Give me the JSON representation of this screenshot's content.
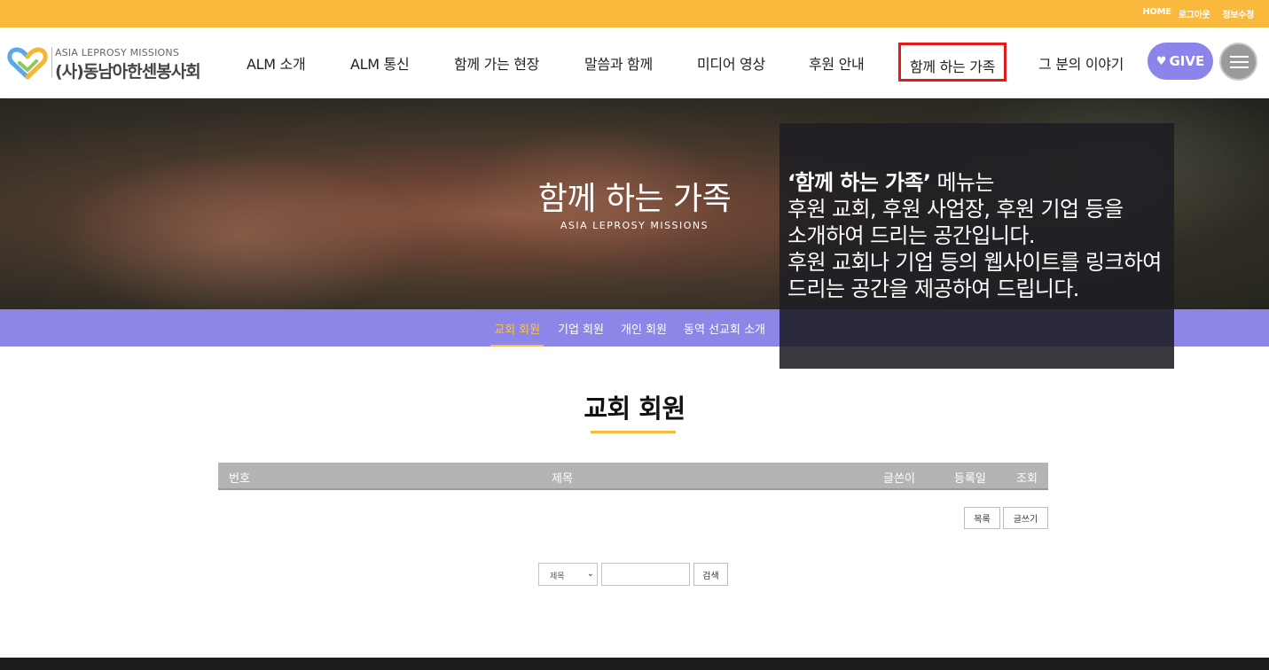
{
  "topbar": {
    "links": [
      "HOME",
      "로그아웃",
      "정보수정"
    ]
  },
  "logo": {
    "sub": "ASIA LEPROSY MISSIONS",
    "name": "(사)동남아한센봉사회"
  },
  "nav": {
    "items": [
      "ALM 소개",
      "ALM 통신",
      "함께 가는 현장",
      "말씀과 함께",
      "미디어 영상",
      "후원 안내",
      "함께 하는 가족",
      "그 분의 이야기"
    ],
    "active_index": 6,
    "give_label": "GIVE"
  },
  "hero": {
    "title": "함께 하는 가족",
    "subtitle": "ASIA LEPROSY MISSIONS"
  },
  "subnav": {
    "tabs": [
      "교회 회원",
      "기업 회원",
      "개인 회원",
      "동역 선교회 소개"
    ],
    "active_index": 0
  },
  "tooltip": {
    "highlight": "‘함께 하는 가족’",
    "line1_rest": " 메뉴는",
    "line2": "후원 교회, 후원 사업장, 후원 기업 등을",
    "line3": "소개하여 드리는 공간입니다.",
    "line4": "후원 교회나 기업 등의 웹사이트를 링크하여",
    "line5": "드리는 공간을 제공하여 드립니다."
  },
  "content": {
    "title": "교회 회원",
    "table_headers": {
      "no": "번호",
      "subject": "제목",
      "author": "글쓴이",
      "date": "등록일",
      "views": "조회"
    },
    "list_button": "목록",
    "write_button": "글쓰기"
  },
  "search": {
    "field_selected": "제목",
    "query": "",
    "button": "검색"
  },
  "colors": {
    "topbar": "#f9b93d",
    "accent_purple": "#8c86e9",
    "active_outline": "#e41b1b",
    "table_header": "#b4b4b4"
  }
}
